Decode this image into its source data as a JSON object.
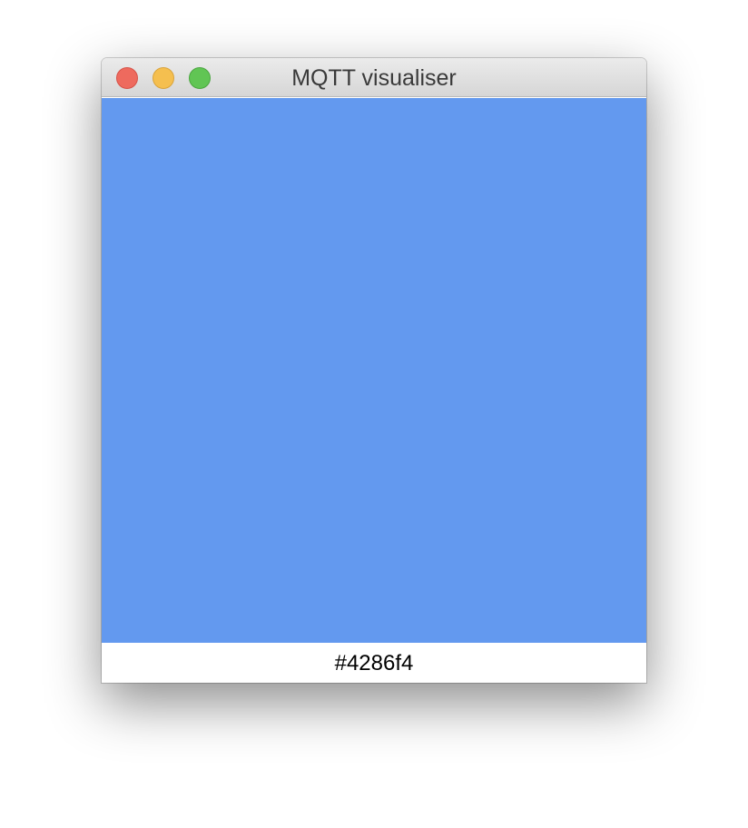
{
  "window": {
    "title": "MQTT visualiser"
  },
  "colors": {
    "close": "#ee6a5e",
    "minimize": "#f5bf4f",
    "zoom": "#61c554",
    "swatch_display": "#6399ef"
  },
  "swatch": {
    "hex_label": "#4286f4"
  }
}
